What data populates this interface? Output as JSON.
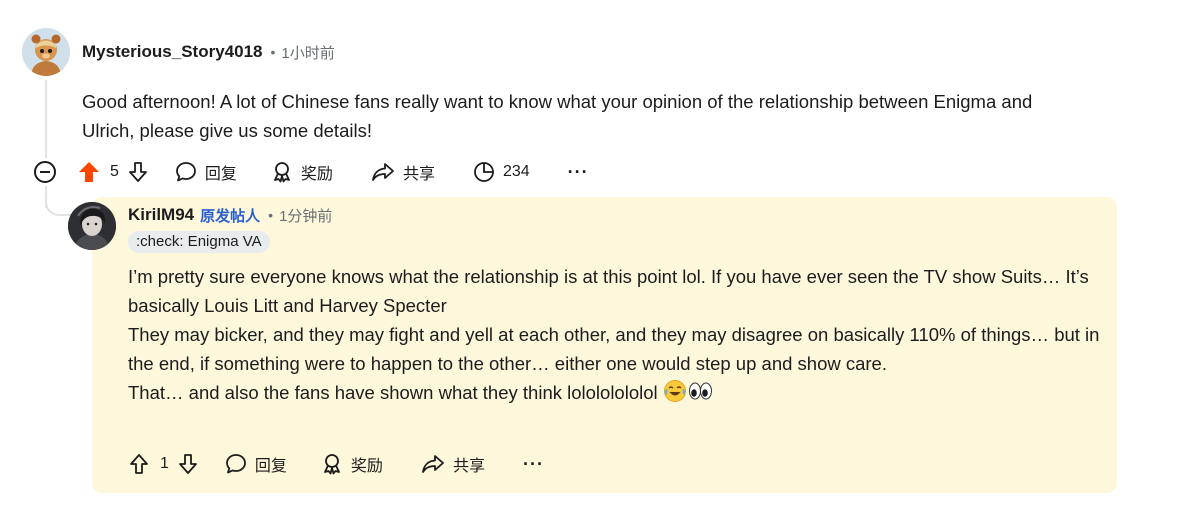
{
  "comment": {
    "username": "Mysterious_Story4018",
    "time": "1小时前",
    "body": "Good afternoon! A lot of Chinese fans really want to know what your opinion of the relationship between Enigma and Ulrich, please give us some details!",
    "votes": "5",
    "reply_label": "回复",
    "award_label": "奖励",
    "share_label": "共享",
    "views": "234",
    "more": "···",
    "upvote_color": "#ff4500"
  },
  "reply": {
    "username": "KirilM94",
    "op_badge": "原发帖人",
    "time": "1分钟前",
    "flair": ":check: Enigma VA",
    "paragraphs": [
      "I’m pretty sure everyone knows what the relationship is at this point lol. If you have ever seen the TV show Suits… It’s basically Louis Litt and Harvey Specter",
      "They may bicker, and they may fight and yell at each other, and they may disagree on basically 110% of things… but in the end, if something were to happen to the other… either one would step up and show care.",
      "That… and also the fans have shown what they think lolololololol"
    ],
    "emojis": [
      "laughing-tears-icon",
      "eyes-icon"
    ],
    "votes": "1",
    "reply_label": "回复",
    "award_label": "奖励",
    "share_label": "共享",
    "more": "···",
    "panel_color": "#fdf8dc",
    "op_color": "#2a5fcf"
  }
}
